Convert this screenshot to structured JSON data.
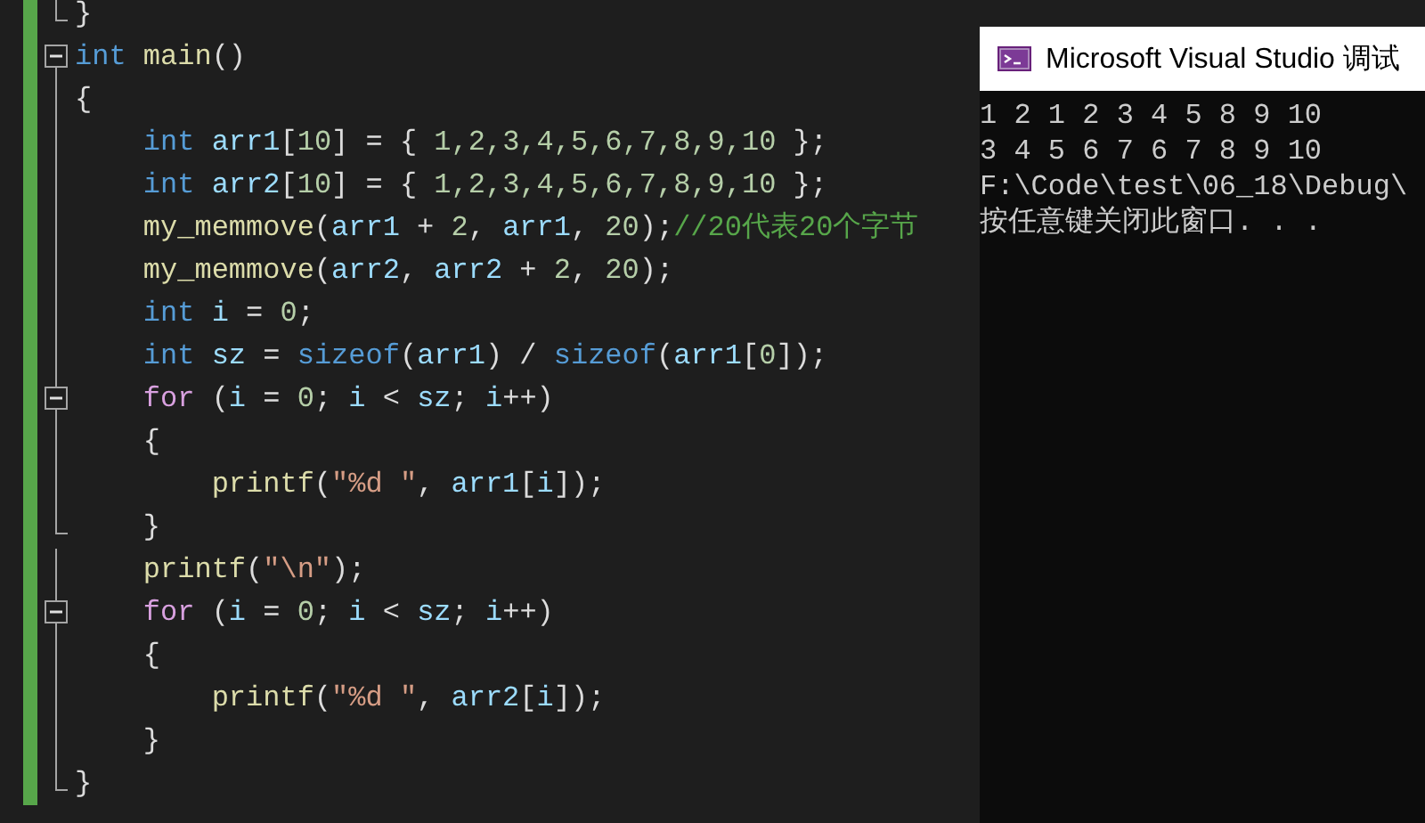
{
  "editor": {
    "lines": [
      {
        "kind": "end",
        "changed": true,
        "tokens": [
          {
            "kind": "plain",
            "text": "}"
          }
        ]
      },
      {
        "kind": "fold",
        "expanded": true,
        "changed": true,
        "tokens": [
          {
            "kind": "keyword",
            "text": "int"
          },
          {
            "kind": "func",
            "text": " main"
          },
          {
            "kind": "plain",
            "text": "()"
          }
        ]
      },
      {
        "kind": "bar",
        "changed": true,
        "tokens": [
          {
            "kind": "plain",
            "text": "{"
          }
        ]
      },
      {
        "kind": "bar",
        "changed": true,
        "tokens": [
          {
            "kind": "keyword",
            "text": "    int"
          },
          {
            "kind": "var",
            "text": " arr1"
          },
          {
            "kind": "plain",
            "text": "["
          },
          {
            "kind": "num",
            "text": "10"
          },
          {
            "kind": "plain",
            "text": "] = { "
          },
          {
            "kind": "num",
            "text": "1,2,3,4,5,6,7,8,9,10"
          },
          {
            "kind": "plain",
            "text": " };"
          }
        ]
      },
      {
        "kind": "bar",
        "changed": true,
        "tokens": [
          {
            "kind": "keyword",
            "text": "    int"
          },
          {
            "kind": "var",
            "text": " arr2"
          },
          {
            "kind": "plain",
            "text": "["
          },
          {
            "kind": "num",
            "text": "10"
          },
          {
            "kind": "plain",
            "text": "] = { "
          },
          {
            "kind": "num",
            "text": "1,2,3,4,5,6,7,8,9,10"
          },
          {
            "kind": "plain",
            "text": " };"
          }
        ]
      },
      {
        "kind": "bar",
        "changed": true,
        "tokens": [
          {
            "kind": "func",
            "text": "    my_memmove"
          },
          {
            "kind": "plain",
            "text": "("
          },
          {
            "kind": "var",
            "text": "arr1"
          },
          {
            "kind": "plain",
            "text": " + "
          },
          {
            "kind": "num",
            "text": "2"
          },
          {
            "kind": "plain",
            "text": ", "
          },
          {
            "kind": "var",
            "text": "arr1"
          },
          {
            "kind": "plain",
            "text": ", "
          },
          {
            "kind": "num",
            "text": "20"
          },
          {
            "kind": "plain",
            "text": ");"
          },
          {
            "kind": "comment",
            "text": "//20代表20个字节"
          }
        ]
      },
      {
        "kind": "bar",
        "changed": true,
        "tokens": [
          {
            "kind": "func",
            "text": "    my_memmove"
          },
          {
            "kind": "plain",
            "text": "("
          },
          {
            "kind": "var",
            "text": "arr2"
          },
          {
            "kind": "plain",
            "text": ", "
          },
          {
            "kind": "var",
            "text": "arr2"
          },
          {
            "kind": "plain",
            "text": " + "
          },
          {
            "kind": "num",
            "text": "2"
          },
          {
            "kind": "plain",
            "text": ", "
          },
          {
            "kind": "num",
            "text": "20"
          },
          {
            "kind": "plain",
            "text": ");"
          }
        ]
      },
      {
        "kind": "bar",
        "changed": true,
        "tokens": [
          {
            "kind": "keyword",
            "text": "    int"
          },
          {
            "kind": "var",
            "text": " i"
          },
          {
            "kind": "plain",
            "text": " = "
          },
          {
            "kind": "num",
            "text": "0"
          },
          {
            "kind": "plain",
            "text": ";"
          }
        ]
      },
      {
        "kind": "bar",
        "changed": true,
        "tokens": [
          {
            "kind": "keyword",
            "text": "    int"
          },
          {
            "kind": "var",
            "text": " sz"
          },
          {
            "kind": "plain",
            "text": " = "
          },
          {
            "kind": "keyword",
            "text": "sizeof"
          },
          {
            "kind": "plain",
            "text": "("
          },
          {
            "kind": "var",
            "text": "arr1"
          },
          {
            "kind": "plain",
            "text": ") / "
          },
          {
            "kind": "keyword",
            "text": "sizeof"
          },
          {
            "kind": "plain",
            "text": "("
          },
          {
            "kind": "var",
            "text": "arr1"
          },
          {
            "kind": "plain",
            "text": "["
          },
          {
            "kind": "num",
            "text": "0"
          },
          {
            "kind": "plain",
            "text": "]);"
          }
        ]
      },
      {
        "kind": "fold",
        "expanded": true,
        "changed": true,
        "tokens": [
          {
            "kind": "control",
            "text": "    for"
          },
          {
            "kind": "plain",
            "text": " ("
          },
          {
            "kind": "var",
            "text": "i"
          },
          {
            "kind": "plain",
            "text": " = "
          },
          {
            "kind": "num",
            "text": "0"
          },
          {
            "kind": "plain",
            "text": "; "
          },
          {
            "kind": "var",
            "text": "i"
          },
          {
            "kind": "plain",
            "text": " < "
          },
          {
            "kind": "var",
            "text": "sz"
          },
          {
            "kind": "plain",
            "text": "; "
          },
          {
            "kind": "var",
            "text": "i"
          },
          {
            "kind": "plain",
            "text": "++)"
          }
        ]
      },
      {
        "kind": "bar",
        "changed": true,
        "tokens": [
          {
            "kind": "plain",
            "text": "    {"
          }
        ]
      },
      {
        "kind": "bar",
        "changed": true,
        "tokens": [
          {
            "kind": "func",
            "text": "        printf"
          },
          {
            "kind": "plain",
            "text": "("
          },
          {
            "kind": "str",
            "text": "\"%d \""
          },
          {
            "kind": "plain",
            "text": ", "
          },
          {
            "kind": "var",
            "text": "arr1"
          },
          {
            "kind": "plain",
            "text": "["
          },
          {
            "kind": "var",
            "text": "i"
          },
          {
            "kind": "plain",
            "text": "]);"
          }
        ]
      },
      {
        "kind": "end",
        "changed": true,
        "tokens": [
          {
            "kind": "plain",
            "text": "    }"
          }
        ]
      },
      {
        "kind": "bar",
        "changed": true,
        "tokens": [
          {
            "kind": "func",
            "text": "    printf"
          },
          {
            "kind": "plain",
            "text": "("
          },
          {
            "kind": "str",
            "text": "\"\\n\""
          },
          {
            "kind": "plain",
            "text": ");"
          }
        ]
      },
      {
        "kind": "fold",
        "expanded": true,
        "changed": true,
        "tokens": [
          {
            "kind": "control",
            "text": "    for"
          },
          {
            "kind": "plain",
            "text": " ("
          },
          {
            "kind": "var",
            "text": "i"
          },
          {
            "kind": "plain",
            "text": " = "
          },
          {
            "kind": "num",
            "text": "0"
          },
          {
            "kind": "plain",
            "text": "; "
          },
          {
            "kind": "var",
            "text": "i"
          },
          {
            "kind": "plain",
            "text": " < "
          },
          {
            "kind": "var",
            "text": "sz"
          },
          {
            "kind": "plain",
            "text": "; "
          },
          {
            "kind": "var",
            "text": "i"
          },
          {
            "kind": "plain",
            "text": "++)"
          }
        ]
      },
      {
        "kind": "bar",
        "changed": true,
        "tokens": [
          {
            "kind": "plain",
            "text": "    {"
          }
        ]
      },
      {
        "kind": "bar",
        "changed": true,
        "tokens": [
          {
            "kind": "func",
            "text": "        printf"
          },
          {
            "kind": "plain",
            "text": "("
          },
          {
            "kind": "str",
            "text": "\"%d \""
          },
          {
            "kind": "plain",
            "text": ", "
          },
          {
            "kind": "var",
            "text": "arr2"
          },
          {
            "kind": "plain",
            "text": "["
          },
          {
            "kind": "var",
            "text": "i"
          },
          {
            "kind": "plain",
            "text": "]);"
          }
        ]
      },
      {
        "kind": "bar",
        "changed": true,
        "tokens": [
          {
            "kind": "plain",
            "text": "    }"
          }
        ]
      },
      {
        "kind": "end",
        "changed": true,
        "tokens": [
          {
            "kind": "plain",
            "text": "}"
          }
        ]
      }
    ]
  },
  "console": {
    "title": "Microsoft Visual Studio 调试",
    "lines": [
      "1 2 1 2 3 4 5 8 9 10",
      "3 4 5 6 7 6 7 8 9 10",
      "F:\\Code\\test\\06_18\\Debug\\",
      "按任意键关闭此窗口. . ."
    ]
  }
}
